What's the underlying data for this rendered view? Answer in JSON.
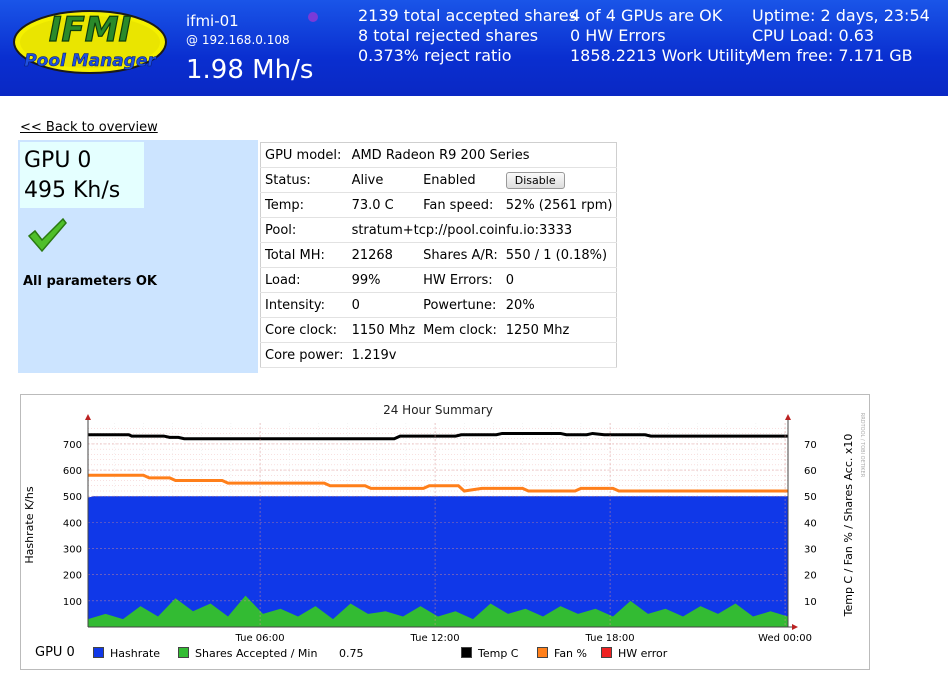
{
  "header": {
    "logo": {
      "line1": "IFMI",
      "line2": "Pool Manager"
    },
    "host_name": "ifmi-01",
    "host_ip": "@ 192.168.0.108",
    "total_hashrate": "1.98 Mh/s",
    "col1": [
      "2139 total accepted shares",
      "8 total rejected shares",
      "0.373% reject ratio"
    ],
    "col2": [
      "4 of 4 GPUs are OK",
      "0 HW Errors",
      "1858.2213 Work Utility"
    ],
    "col3": [
      "Uptime: 2 days, 23:54",
      "CPU Load: 0.63",
      "Mem free: 7.171 GB"
    ]
  },
  "nav": {
    "back": "<< Back to overview"
  },
  "gpu": {
    "name": "GPU 0",
    "rate": "495 Kh/s",
    "status_message": "All parameters OK"
  },
  "details": {
    "model_label": "GPU model:",
    "model": "AMD Radeon R9 200 Series",
    "status_label": "Status:",
    "status": "Alive",
    "enabled": "Enabled",
    "disable_button": "Disable",
    "temp_label": "Temp:",
    "temp": "73.0 C",
    "fan_label": "Fan speed:",
    "fan": "52% (2561 rpm)",
    "pool_label": "Pool:",
    "pool": "stratum+tcp://pool.coinfu.io:3333",
    "total_mh_label": "Total MH:",
    "total_mh": "21268",
    "shares_label": "Shares A/R:",
    "shares": "550 / 1 (0.18%)",
    "load_label": "Load:",
    "load": "99%",
    "hw_label": "HW Errors:",
    "hw": "0",
    "intensity_label": "Intensity:",
    "intensity": "0",
    "powertune_label": "Powertune:",
    "powertune": "20%",
    "core_clock_label": "Core clock:",
    "core_clock": "1150 Mhz",
    "mem_clock_label": "Mem clock:",
    "mem_clock": "1250 Mhz",
    "core_power_label": "Core power:",
    "core_power": "1.219v"
  },
  "colors": {
    "hashrate": "#1038e8",
    "shares": "#33bb33",
    "temp": "#000000",
    "fan": "#ff7f1a",
    "hw": "#ee2222"
  },
  "chart_data": {
    "type": "area",
    "title": "24 Hour Summary",
    "ylabel": "Hashrate K/hs",
    "y2label": "Temp C / Fan % / Shares Acc. x10",
    "watermark": "RRDTOOL / TOBI OETIKER",
    "ylim": [
      0,
      780
    ],
    "y2lim": [
      0,
      78
    ],
    "yticks": [
      100,
      200,
      300,
      400,
      500,
      600,
      700
    ],
    "y2ticks": [
      10,
      20,
      30,
      40,
      50,
      60,
      70
    ],
    "xticks": [
      "Tue 06:00",
      "Tue 12:00",
      "Tue 18:00",
      "Wed 00:00"
    ],
    "xtick_hours": [
      6,
      12,
      18,
      24
    ],
    "xlim_hours": [
      0.1,
      24.1
    ],
    "series": [
      {
        "name": "Hashrate",
        "color": "#1038e8",
        "style": "area",
        "points": [
          [
            0.1,
            495
          ],
          [
            0.3,
            500
          ],
          [
            24.1,
            500
          ]
        ]
      },
      {
        "name": "Temp C",
        "axis": "right",
        "color": "#000000",
        "style": "line",
        "points": [
          [
            0.1,
            73.5
          ],
          [
            1.5,
            73.5
          ],
          [
            1.6,
            73
          ],
          [
            2.7,
            73
          ],
          [
            2.9,
            72.5
          ],
          [
            3.2,
            72.5
          ],
          [
            3.4,
            72
          ],
          [
            10.6,
            72
          ],
          [
            10.8,
            73
          ],
          [
            12.7,
            73
          ],
          [
            12.9,
            73.5
          ],
          [
            14.1,
            73.5
          ],
          [
            14.3,
            74
          ],
          [
            16.3,
            74
          ],
          [
            16.5,
            73.5
          ],
          [
            17.2,
            73.5
          ],
          [
            17.4,
            74
          ],
          [
            17.8,
            73.5
          ],
          [
            19.2,
            73.5
          ],
          [
            19.4,
            73
          ],
          [
            24.1,
            73
          ]
        ]
      },
      {
        "name": "Fan %",
        "axis": "right",
        "color": "#ff7f1a",
        "style": "line",
        "points": [
          [
            0.1,
            58
          ],
          [
            2.0,
            58
          ],
          [
            2.2,
            57
          ],
          [
            2.9,
            57
          ],
          [
            3.1,
            56
          ],
          [
            4.7,
            56
          ],
          [
            4.9,
            55
          ],
          [
            8.2,
            55
          ],
          [
            8.4,
            54
          ],
          [
            9.6,
            54
          ],
          [
            9.8,
            53
          ],
          [
            11.6,
            53
          ],
          [
            11.8,
            54
          ],
          [
            12.8,
            54
          ],
          [
            13.0,
            52
          ],
          [
            13.6,
            53
          ],
          [
            15.0,
            53
          ],
          [
            15.2,
            52
          ],
          [
            16.8,
            52
          ],
          [
            17.0,
            53
          ],
          [
            18.1,
            53
          ],
          [
            18.3,
            52
          ],
          [
            24.1,
            52
          ]
        ]
      },
      {
        "name": "Shares Accepted / Min",
        "axis": "right",
        "scale": "x10",
        "color": "#33bb33",
        "style": "area",
        "current": "0.75",
        "points": [
          [
            0.1,
            3
          ],
          [
            0.7,
            5
          ],
          [
            1.3,
            3
          ],
          [
            1.9,
            8
          ],
          [
            2.5,
            4
          ],
          [
            3.1,
            11
          ],
          [
            3.7,
            6
          ],
          [
            4.3,
            9
          ],
          [
            4.9,
            4
          ],
          [
            5.5,
            12
          ],
          [
            6.1,
            5
          ],
          [
            6.7,
            7
          ],
          [
            7.3,
            4
          ],
          [
            7.9,
            8
          ],
          [
            8.5,
            3
          ],
          [
            9.1,
            9
          ],
          [
            9.7,
            5
          ],
          [
            10.3,
            6
          ],
          [
            10.9,
            4
          ],
          [
            11.5,
            8
          ],
          [
            12.1,
            4
          ],
          [
            12.7,
            6
          ],
          [
            13.3,
            3
          ],
          [
            13.9,
            9
          ],
          [
            14.5,
            5
          ],
          [
            15.1,
            7
          ],
          [
            15.7,
            4
          ],
          [
            16.3,
            8
          ],
          [
            16.9,
            5
          ],
          [
            17.5,
            7
          ],
          [
            18.1,
            4
          ],
          [
            18.7,
            10
          ],
          [
            19.3,
            5
          ],
          [
            19.9,
            7
          ],
          [
            20.5,
            4
          ],
          [
            21.1,
            8
          ],
          [
            21.7,
            5
          ],
          [
            22.3,
            9
          ],
          [
            22.9,
            4
          ],
          [
            23.5,
            6
          ],
          [
            24.1,
            4
          ]
        ]
      },
      {
        "name": "HW error",
        "color": "#ee2222",
        "style": "line",
        "points": []
      }
    ],
    "legend": {
      "gpu_label": "GPU 0",
      "items": [
        {
          "name": "Hashrate",
          "color": "#1038e8"
        },
        {
          "name": "Shares Accepted / Min",
          "color": "#33bb33"
        },
        {
          "name": "0.75",
          "color": ""
        },
        {
          "name": "Temp C",
          "color": "#000000"
        },
        {
          "name": "Fan %",
          "color": "#ff7f1a"
        },
        {
          "name": "HW error",
          "color": "#ee2222"
        }
      ]
    }
  }
}
